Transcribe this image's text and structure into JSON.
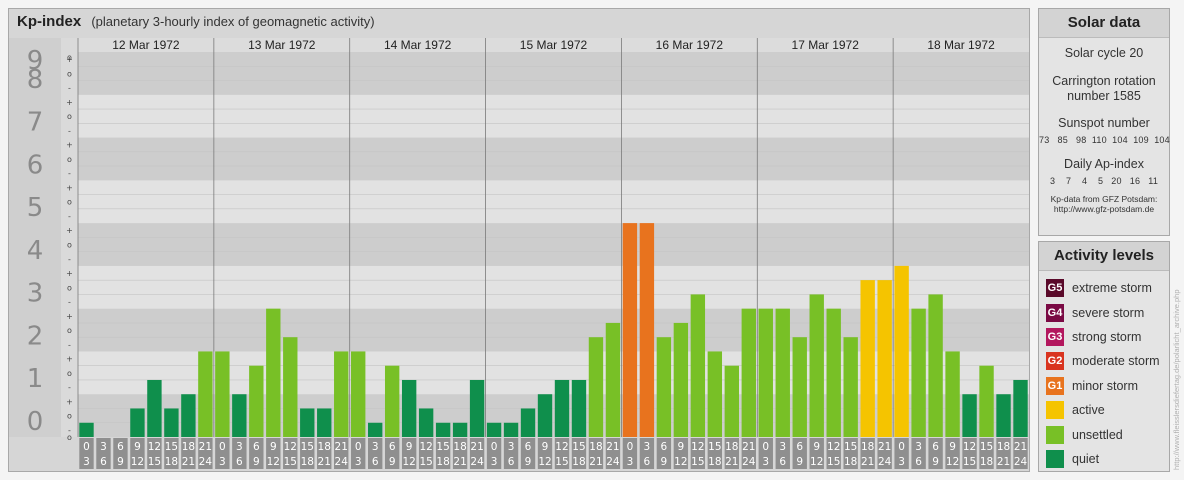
{
  "title": {
    "main": "Kp-index",
    "subtitle": "(planetary 3-hourly index of geomagnetic activity)"
  },
  "solar": {
    "title": "Solar data",
    "cycle": "Solar cycle 20",
    "carrington_1": "Carrington rotation",
    "carrington_2": "number 1585",
    "sunspot_title": "Sunspot number",
    "sunspot_values": "73   85   98  110  104  109  104",
    "ap_title": "Daily Ap-index",
    "ap_values": "3    7    4    5   20   16   11",
    "credit_1": "Kp-data from GFZ Potsdam:",
    "credit_2": "http://www.gfz-potsdam.de"
  },
  "activity": {
    "title": "Activity levels",
    "levels": [
      {
        "badge": "G5",
        "label": "extreme storm",
        "color": "#5a0a2a"
      },
      {
        "badge": "G4",
        "label": "severe storm",
        "color": "#7a0a44"
      },
      {
        "badge": "G3",
        "label": "strong storm",
        "color": "#b3175e"
      },
      {
        "badge": "G2",
        "label": "moderate storm",
        "color": "#d9341f"
      },
      {
        "badge": "G1",
        "label": "minor storm",
        "color": "#e8731e"
      },
      {
        "badge": "",
        "label": "active",
        "color": "#f5c400"
      },
      {
        "badge": "",
        "label": "unsettled",
        "color": "#78c026"
      },
      {
        "badge": "",
        "label": "quiet",
        "color": "#0f8f4c"
      }
    ]
  },
  "watermark": "http://www.fleisslersdiefertag.de/polarlicht_archive.php",
  "chart_data": {
    "type": "bar",
    "ylim": [
      0,
      9
    ],
    "y_ticks": [
      "0",
      "1",
      "2",
      "3",
      "4",
      "5",
      "6",
      "7",
      "8",
      "9"
    ],
    "sub_ticks": [
      "-",
      "o",
      "+"
    ],
    "days": [
      "12 Mar 1972",
      "13 Mar 1972",
      "14 Mar 1972",
      "15 Mar 1972",
      "16 Mar 1972",
      "17 Mar 1972",
      "18 Mar 1972"
    ],
    "hour_start_labels": [
      "0",
      "3",
      "6",
      "9",
      "12",
      "15",
      "18",
      "21"
    ],
    "hour_end_labels": [
      "3",
      "6",
      "9",
      "12",
      "15",
      "18",
      "21",
      "24"
    ],
    "values": [
      [
        0.333,
        0,
        0,
        0.667,
        1.333,
        0.667,
        1,
        2
      ],
      [
        2,
        1,
        1.667,
        3,
        2.333,
        0.667,
        0.667,
        2
      ],
      [
        2,
        0.333,
        1.667,
        1.333,
        0.667,
        0.333,
        0.333,
        1.333
      ],
      [
        0.333,
        0.333,
        0.667,
        1,
        1.333,
        1.333,
        2.333,
        2.667
      ],
      [
        5,
        5,
        2.333,
        2.667,
        3.333,
        2,
        1.667,
        3
      ],
      [
        3,
        3,
        2.333,
        3.333,
        3,
        2.333,
        3.667,
        3.667
      ],
      [
        4,
        3,
        3.333,
        2,
        1,
        1.667,
        1,
        1.333
      ]
    ],
    "colors": {
      "quiet": "#0f8f4c",
      "unsettled": "#78c026",
      "active": "#f5c400",
      "minor_storm": "#e8731e"
    }
  }
}
